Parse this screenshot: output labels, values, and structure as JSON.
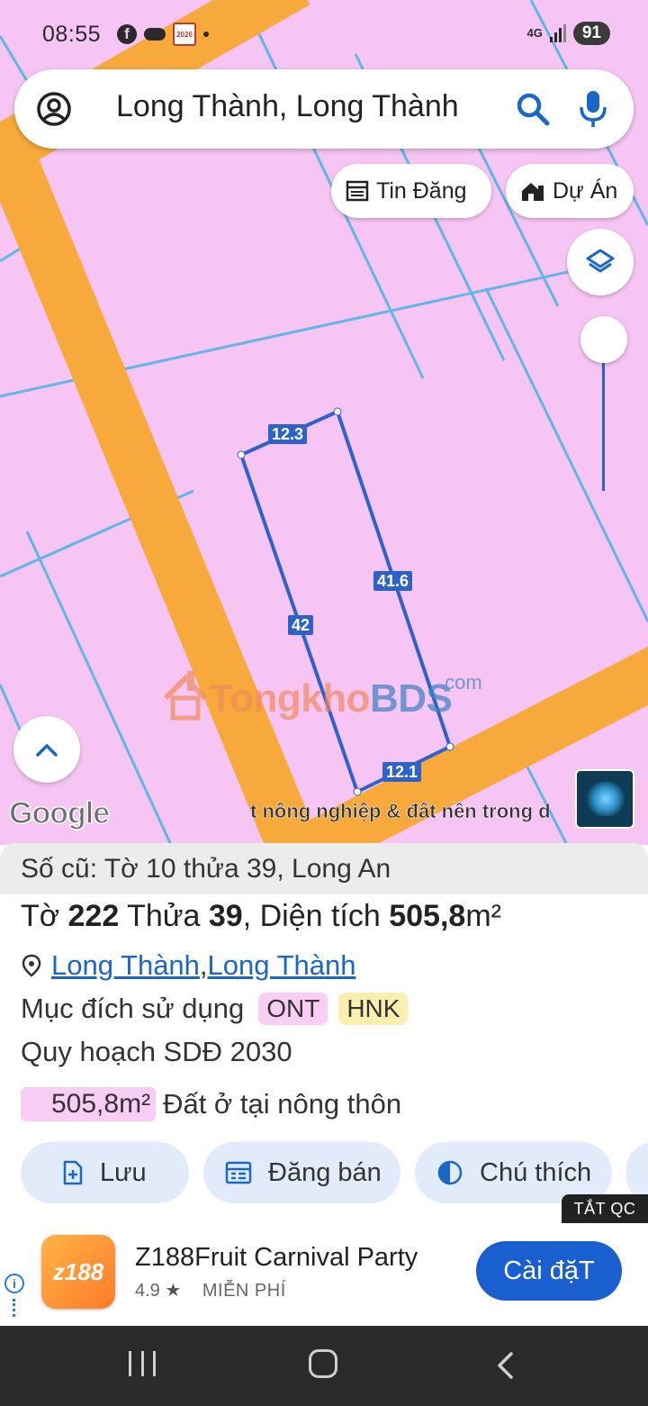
{
  "status_bar": {
    "time": "08:55",
    "calendar_badge": "2026",
    "network": "4G",
    "battery": "91"
  },
  "search": {
    "text": "Long Thành, Long Thành"
  },
  "chips": {
    "tin_dang": "Tin Đăng",
    "du_an": "Dự Án"
  },
  "map": {
    "segment_labels": {
      "top": "12.3",
      "right": "41.6",
      "left": "42",
      "bottom": "12.1"
    },
    "google_logo": "Google",
    "watermark_main_a": "Tongkho",
    "watermark_main_b": "BDS",
    "watermark_suffix": ".com",
    "ticker": "t nông nghiệp & đất nền trong d",
    "colors": {
      "land": "#f7c5f3",
      "road": "#f8a93c",
      "boundary": "#5fb6e8",
      "parcel": "#2d63c9"
    }
  },
  "info": {
    "old_number": "Số cũ: Tờ 10 thửa 39, Long An",
    "sheet_label": "Tờ ",
    "sheet": "222",
    "plot_label": " Thửa ",
    "plot": "39",
    "area_label": ", Diện tích ",
    "area": "505,8",
    "area_unit": "m²",
    "location_1": "Long Thành",
    "location_sep": ", ",
    "location_2": "Long Thành",
    "purpose_label": "Mục đích sử dụng",
    "purpose_codes": [
      "ONT",
      "HNK"
    ],
    "plan_label": "Quy hoạch SDĐ 2030",
    "land_area_chip": "505,8m²",
    "land_type": "Đất ở tại nông thôn"
  },
  "actions": {
    "save": "Lưu",
    "post_sale": "Đăng bán",
    "legend": "Chú thích"
  },
  "ad": {
    "close_label": "TẮT QC",
    "app_icon_text": "z188",
    "title": "Z188Fruit Carnival Party",
    "rating": "4.9",
    "star": "★",
    "price": "MIỄN PHÍ",
    "install": "Cài đặT",
    "info": "i"
  }
}
